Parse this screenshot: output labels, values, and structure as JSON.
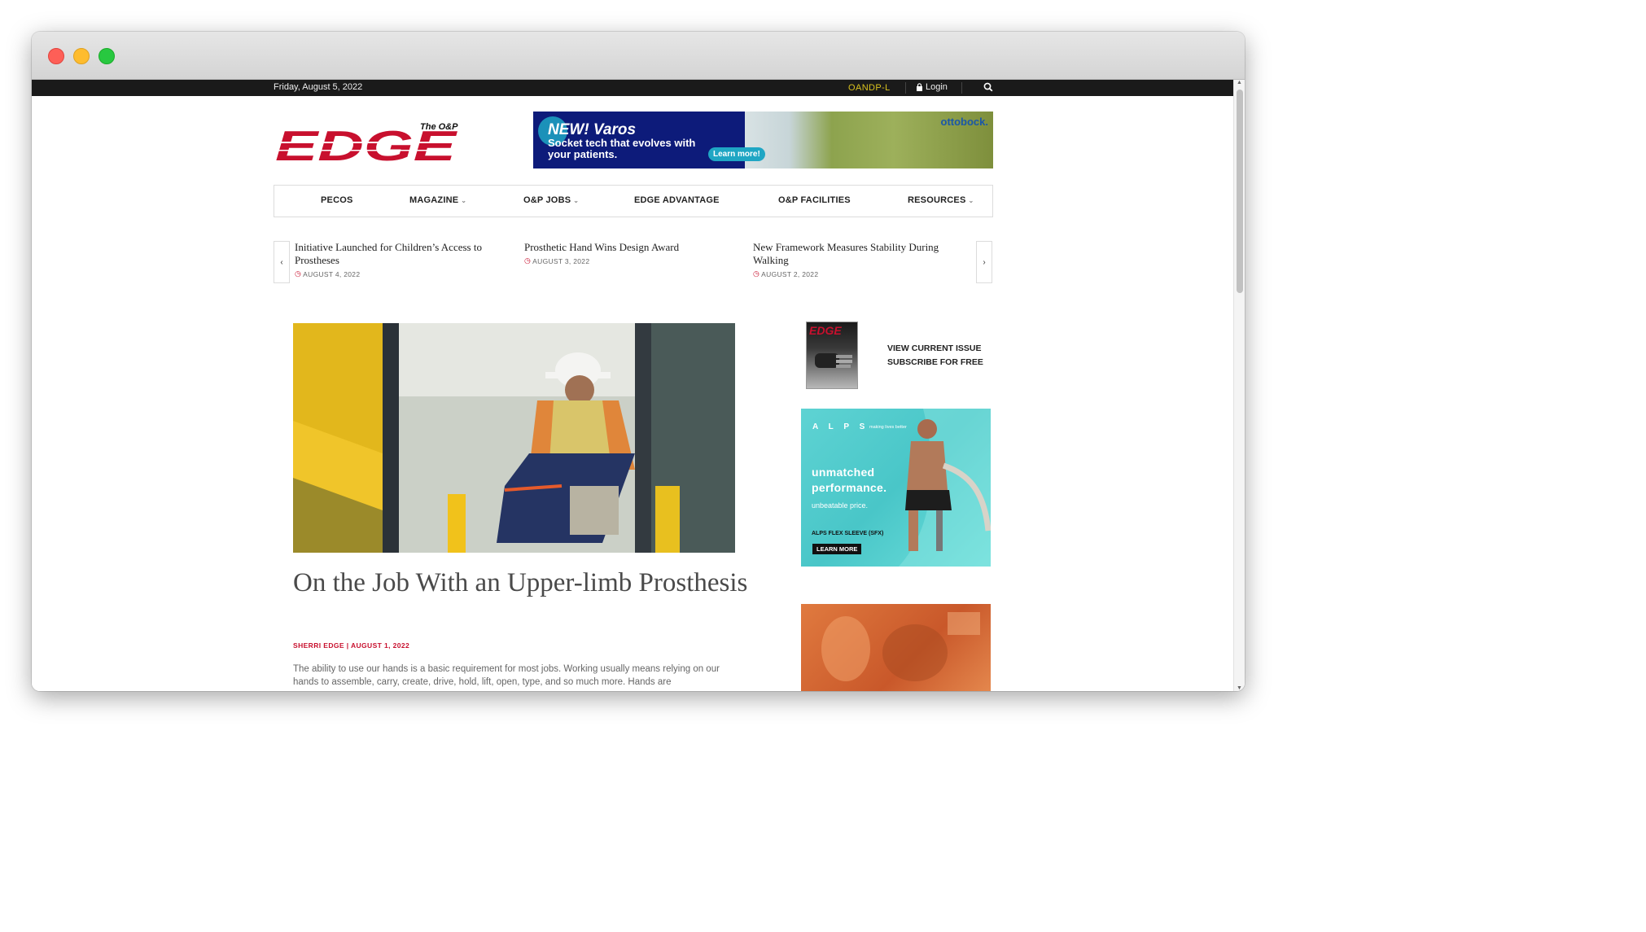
{
  "topbar": {
    "date": "Friday, August 5, 2022",
    "oandp": "OANDP-L",
    "login": "Login"
  },
  "logo": {
    "small": "The O&P",
    "big": "EDGE"
  },
  "banner": {
    "headline": "NEW! Varos",
    "subline": "Socket tech that evolves with your patients.",
    "cta": "Learn more!",
    "brand": "ottobock."
  },
  "nav": [
    {
      "label": "PECOS",
      "has_menu": false
    },
    {
      "label": "MAGAZINE",
      "has_menu": true
    },
    {
      "label": "O&P JOBS",
      "has_menu": true
    },
    {
      "label": "EDGE ADVANTAGE",
      "has_menu": false
    },
    {
      "label": "O&P FACILITIES",
      "has_menu": false
    },
    {
      "label": "RESOURCES",
      "has_menu": true
    }
  ],
  "ticker": [
    {
      "title": "Initiative Launched for Children’s Access to Prostheses",
      "date": "AUGUST 4, 2022"
    },
    {
      "title": "Prosthetic Hand Wins Design Award",
      "date": "AUGUST 3, 2022"
    },
    {
      "title": "New Framework Measures Stability During Walking",
      "date": "AUGUST 2, 2022"
    }
  ],
  "article": {
    "title": "On the Job With an Upper-limb Prosthesis",
    "byline": "SHERRI EDGE | AUGUST 1, 2022",
    "excerpt": "The ability to use our hands is a basic requirement for most jobs. Working usually means relying on our hands to assemble, carry, create, drive, hold, lift, open, type, and so much more. Hands are"
  },
  "sidebar": {
    "magazine_logo": "EDGE",
    "view_issue": "VIEW CURRENT ISSUE",
    "subscribe": "SUBSCRIBE FOR FREE"
  },
  "alps_ad": {
    "brand": "A L P S",
    "tagline": "making lives better",
    "headline_1": "unmatched",
    "headline_2": "performance.",
    "sub": "unbeatable price.",
    "product": "ALPS FLEX SLEEVE (SFX)",
    "cta": "LEARN MORE"
  },
  "colors": {
    "brand_red": "#c8102e",
    "topbar": "#1a1a1a",
    "oandp": "#d9c21e",
    "banner_blue": "#0d1b7a",
    "banner_teal": "#1fa6c4",
    "alps_teal": "#49c6c8"
  }
}
